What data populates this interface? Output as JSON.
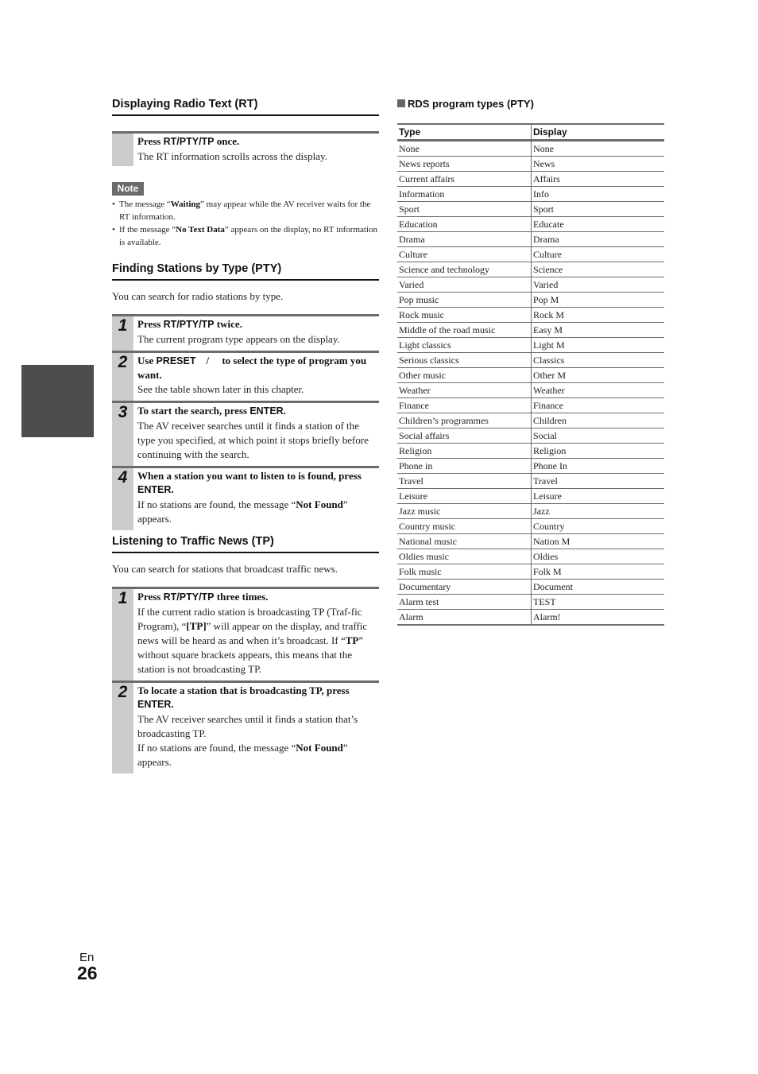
{
  "page": {
    "language": "En",
    "number": "26"
  },
  "rt_section": {
    "title": "Displaying Radio Text (RT)",
    "step": {
      "head_pre": "Press ",
      "head_key": "RT/PTY/TP",
      "head_post": " once.",
      "body": "The RT information scrolls across the display."
    },
    "note_label": "Note",
    "notes": [
      {
        "pre": "The message “",
        "bold": "Waiting",
        "post": "” may appear while the AV receiver waits for the RT information."
      },
      {
        "pre": "If the message “",
        "bold": "No Text Data",
        "post": "” appears on the display, no RT information is available."
      }
    ]
  },
  "pty_section": {
    "title": "Finding Stations by Type (PTY)",
    "intro": "You can search for radio stations by type.",
    "steps": [
      {
        "num": "1",
        "head_pre": "Press ",
        "head_key": "RT/PTY/TP",
        "head_post": " twice.",
        "body": "The current program type appears on the display."
      },
      {
        "num": "2",
        "head_pre": "Use ",
        "head_key": "PRESET",
        "head_post": "    /     to select the type of program you want.",
        "body": "See the table shown later in this chapter."
      },
      {
        "num": "3",
        "head_pre": "To start the search, press ",
        "head_key": "ENTER",
        "head_post": ".",
        "body": "The AV receiver searches until it finds a station of the type you specified, at which point it stops briefly before continuing with the search."
      },
      {
        "num": "4",
        "head_pre": "When a station you want to listen to is found, press ",
        "head_key": "ENTER",
        "head_post": ".",
        "body_pre": "If no stations are found, the message “",
        "body_bold": "Not Found",
        "body_post": "” appears."
      }
    ]
  },
  "tp_section": {
    "title": "Listening to Traffic News (TP)",
    "intro": "You can search for stations that broadcast traffic news.",
    "steps": [
      {
        "num": "1",
        "head_pre": "Press ",
        "head_key": "RT/PTY/TP",
        "head_post": " three times.",
        "body_1": "If the current radio station is broadcasting TP (Traf-fic Program), “",
        "body_1_bold": "[TP]",
        "body_2": "” will appear on the display, and traffic news will be heard as and when it’s broadcast. If “",
        "body_2_bold": "TP",
        "body_3": "” without square brackets appears, this means that the station is not broadcasting TP."
      },
      {
        "num": "2",
        "head_pre": "To locate a station that is broadcasting TP, press ",
        "head_key": "ENTER",
        "head_post": ".",
        "body": "The AV receiver searches until it finds a station that’s broadcasting TP.",
        "body_pre": "If no stations are found, the message “",
        "body_bold": "Not Found",
        "body_post": "” appears."
      }
    ]
  },
  "rds_table": {
    "title": "RDS program types (PTY)",
    "columns": [
      "Type",
      "Display"
    ],
    "rows": [
      [
        "None",
        "None"
      ],
      [
        "News reports",
        "News"
      ],
      [
        "Current affairs",
        "Affairs"
      ],
      [
        "Information",
        "Info"
      ],
      [
        "Sport",
        "Sport"
      ],
      [
        "Education",
        "Educate"
      ],
      [
        "Drama",
        "Drama"
      ],
      [
        "Culture",
        "Culture"
      ],
      [
        "Science and technology",
        "Science"
      ],
      [
        "Varied",
        "Varied"
      ],
      [
        "Pop music",
        "Pop M"
      ],
      [
        "Rock music",
        "Rock M"
      ],
      [
        "Middle of the road music",
        "Easy M"
      ],
      [
        "Light classics",
        "Light M"
      ],
      [
        "Serious classics",
        "Classics"
      ],
      [
        "Other music",
        "Other M"
      ],
      [
        "Weather",
        "Weather"
      ],
      [
        "Finance",
        "Finance"
      ],
      [
        "Children’s programmes",
        "Children"
      ],
      [
        "Social affairs",
        "Social"
      ],
      [
        "Religion",
        "Religion"
      ],
      [
        "Phone in",
        "Phone In"
      ],
      [
        "Travel",
        "Travel"
      ],
      [
        "Leisure",
        "Leisure"
      ],
      [
        "Jazz music",
        "Jazz"
      ],
      [
        "Country music",
        "Country"
      ],
      [
        "National music",
        "Nation M"
      ],
      [
        "Oldies music",
        "Oldies"
      ],
      [
        "Folk music",
        "Folk M"
      ],
      [
        "Documentary",
        "Document"
      ],
      [
        "Alarm test",
        "TEST"
      ],
      [
        "Alarm",
        "Alarm!"
      ]
    ]
  }
}
